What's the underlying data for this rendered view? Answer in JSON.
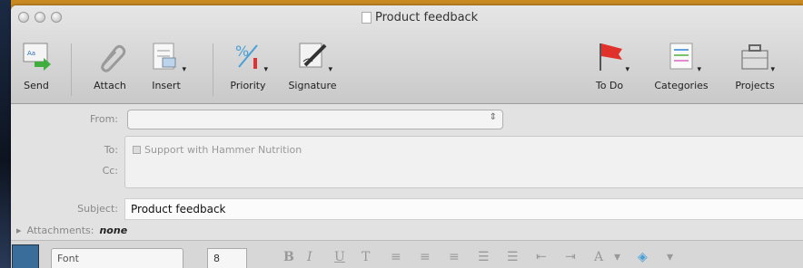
{
  "window": {
    "title": "Product feedback"
  },
  "toolbar": {
    "send": "Send",
    "attach": "Attach",
    "insert": "Insert",
    "priority": "Priority",
    "signature": "Signature",
    "todo": "To Do",
    "categories": "Categories",
    "projects": "Projects"
  },
  "form": {
    "from_label": "From:",
    "from_value": "",
    "to_label": "To:",
    "cc_label": "Cc:",
    "to_value": "Support with Hammer Nutrition",
    "subject_label": "Subject:",
    "subject_value": "Product feedback",
    "attachments_label": "Attachments:",
    "attachments_value": "none"
  },
  "format_bar": {
    "font_value": "Font",
    "size_value": "8",
    "buttons": [
      "B",
      "I",
      "U",
      "T"
    ]
  },
  "colors": {
    "accent": "#c98a22",
    "flag": "#e0322a"
  }
}
